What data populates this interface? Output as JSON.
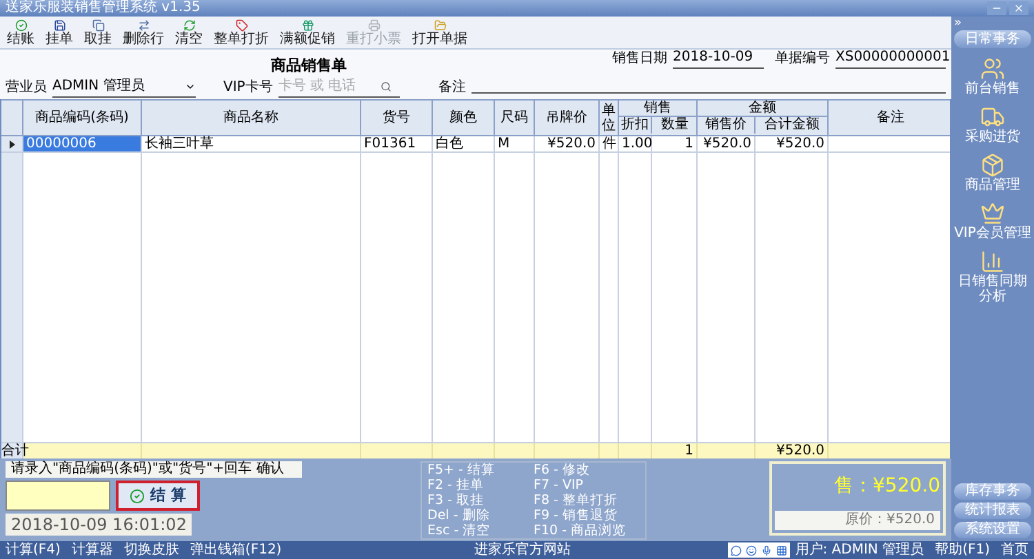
{
  "window": {
    "title": "送家乐服装销售管理系统 v1.35"
  },
  "toolbar": [
    {
      "label": "结账",
      "disabled": false
    },
    {
      "label": "挂单",
      "disabled": false
    },
    {
      "label": "取挂",
      "disabled": false
    },
    {
      "label": "删除行",
      "disabled": false
    },
    {
      "label": "清空",
      "disabled": false
    },
    {
      "label": "整单打折",
      "disabled": false
    },
    {
      "label": "满额促销",
      "disabled": false
    },
    {
      "label": "重打小票",
      "disabled": true
    },
    {
      "label": "打开单据",
      "disabled": false
    }
  ],
  "form": {
    "title": "商品销售单",
    "sale_date_label": "销售日期",
    "sale_date": "2018-10-09",
    "bill_no_label": "单据编号",
    "bill_no": "XS00000000001",
    "clerk_label": "营业员",
    "clerk": "ADMIN 管理员",
    "vip_label": "VIP卡号",
    "vip_placeholder": "卡号 或 电话",
    "note_label": "备注"
  },
  "table": {
    "column_groups": [
      "销售",
      "金额"
    ],
    "columns": [
      {
        "label": "商品编码(条码)",
        "grouped": false
      },
      {
        "label": "商品名称",
        "grouped": false
      },
      {
        "label": "货号",
        "grouped": false
      },
      {
        "label": "颜色",
        "grouped": false
      },
      {
        "label": "尺码",
        "grouped": false
      },
      {
        "label": "吊牌价",
        "grouped": false
      },
      {
        "label": "单位",
        "grouped": false
      },
      {
        "label": "折扣",
        "grouped": true
      },
      {
        "label": "数量",
        "grouped": true
      },
      {
        "label": "销售价",
        "grouped": true
      },
      {
        "label": "合计金额",
        "grouped": true
      },
      {
        "label": "备注",
        "grouped": false
      }
    ],
    "rows": [
      {
        "selected": true,
        "cells": [
          "00000006",
          "长袖三叶草",
          "F01361",
          "白色",
          "M",
          "¥520.0",
          "件",
          "1.00",
          "1",
          "¥520.0",
          "¥520.0"
        ]
      }
    ],
    "total": {
      "label": "合计",
      "quantity": "1",
      "amount": "¥520.0"
    }
  },
  "entry": {
    "hint": "请录入\"商品编码(条码)\"或\"货号\"+回车 确认",
    "checkout": "结 算",
    "clock": "2018-10-09 16:01:02"
  },
  "hotkeys": [
    [
      "F5+ - 结算",
      "F6 - 修改"
    ],
    [
      "F2 - 挂单",
      "F7 - VIP"
    ],
    [
      "F3 - 取挂",
      "F8 - 整单打折"
    ],
    [
      "Del - 删除",
      "F9 - 销售退货"
    ],
    [
      "Esc - 清空",
      "F10 - 商品浏览"
    ]
  ],
  "price": {
    "sale": "售：¥520.0",
    "original": "原价：¥520.0"
  },
  "sidebar": {
    "toggle": "»",
    "header": "日常事务",
    "items": [
      "前台销售",
      "采购进货",
      "商品管理",
      "VIP会员管理",
      "日销售同期分析"
    ],
    "sections": [
      "库存事务",
      "统计报表",
      "系统设置"
    ]
  },
  "status_bar": {
    "left": [
      "计算(F4)",
      "计算器",
      "切换皮肤",
      "弹出钱箱(F12)"
    ],
    "center": "进家乐官方网站",
    "right": [
      "用户: ADMIN 管理员",
      "帮助(F1)",
      "首页"
    ]
  }
}
